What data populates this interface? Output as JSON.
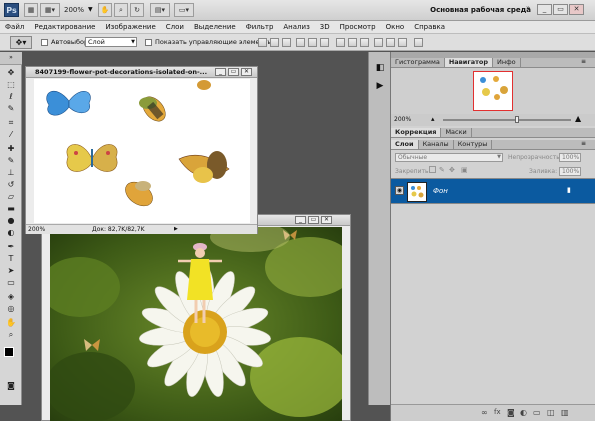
{
  "app": {
    "logo": "Ps",
    "zoom": "200%",
    "workspace": "Основная рабочая среда"
  },
  "menu": [
    "Файл",
    "Редактирование",
    "Изображение",
    "Слои",
    "Выделение",
    "Фильтр",
    "Анализ",
    "3D",
    "Просмотр",
    "Окно",
    "Справка"
  ],
  "options": {
    "autoselect_label": "Автовыбор:",
    "autoselect_value": "Слой",
    "show_controls_label": "Показать управляющие элементы"
  },
  "doc1": {
    "title": "8407199-flower-pot-decorations-isolated-on-...",
    "zoom": "200%",
    "status": "Док: 82,7K/82,7K"
  },
  "navigator": {
    "tabs": [
      "Гистограмма",
      "Навигатор",
      "Инфо"
    ],
    "zoom": "200%"
  },
  "adjust": {
    "tabs": [
      "Коррекция",
      "Маски"
    ]
  },
  "layers": {
    "tabs": [
      "Слои",
      "Каналы",
      "Контуры"
    ],
    "blend_mode": "Обычные",
    "opacity_label": "Непрозрачность:",
    "opacity_value": "100%",
    "lock_label": "Закрепить:",
    "fill_label": "Заливка:",
    "fill_value": "100%",
    "rows": [
      {
        "name": "Фон"
      }
    ]
  },
  "colors": {
    "selection": "#0b5aa0",
    "nav_box": "#e23030"
  }
}
